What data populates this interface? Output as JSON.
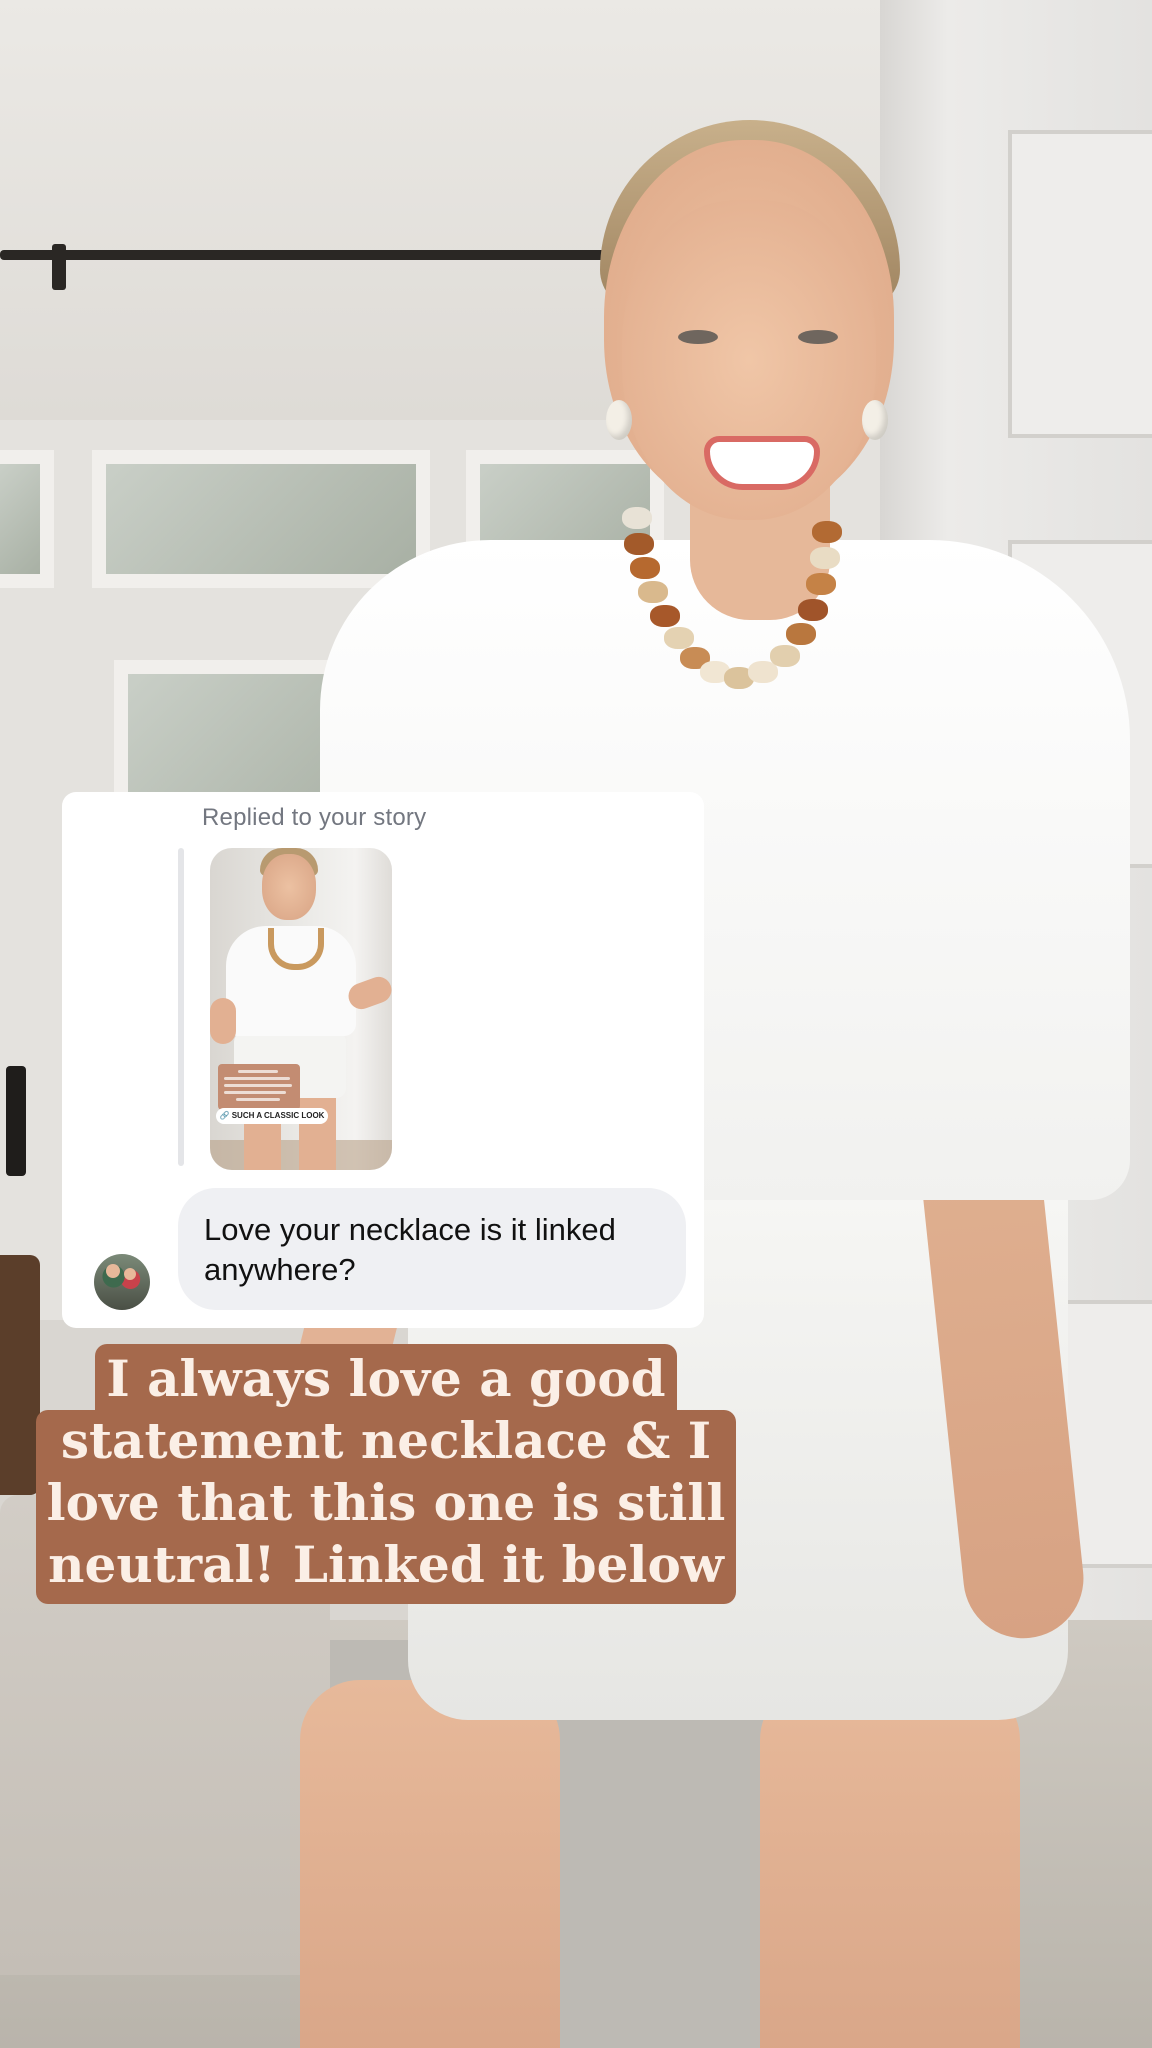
{
  "dm": {
    "reply_label": "Replied to your story",
    "story_thumbnail": {
      "link_sticker": "SUCH A CLASSIC LOOK"
    },
    "message": "Love your necklace is it linked anywhere?"
  },
  "caption": {
    "lines": [
      "I always love a good",
      "statement necklace & I",
      "love that this one is still",
      "neutral! Linked it below"
    ],
    "background_color": "#a5694c",
    "text_color": "#fbefe6"
  }
}
